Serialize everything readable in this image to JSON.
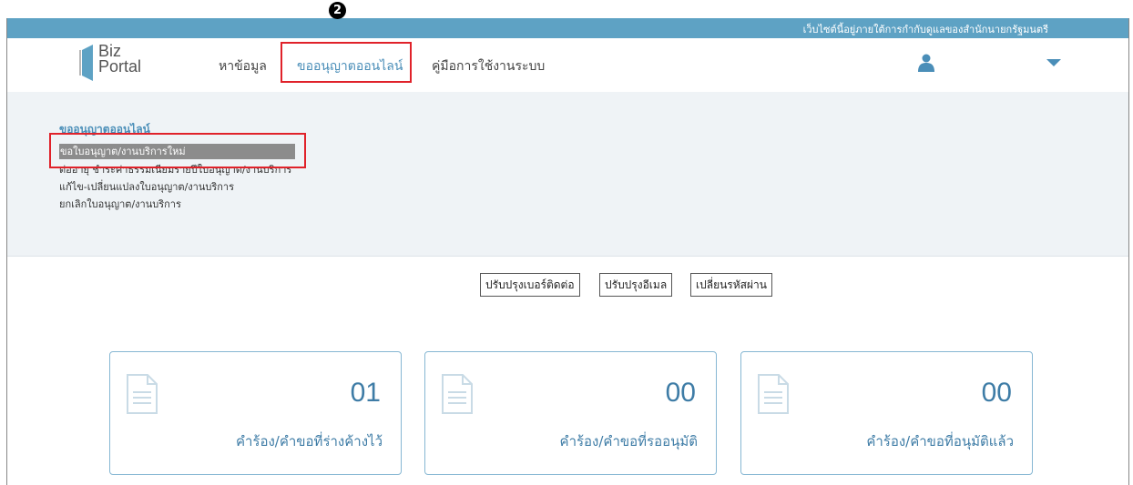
{
  "annotation": {
    "step_number": "2"
  },
  "gov_banner": {
    "text": "เว็บไซต์นี้อยู่ภายใต้การกำกับดูแลของสำนักนายกรัฐมนตรี"
  },
  "logo": {
    "line1": "Biz",
    "line2": "Portal"
  },
  "nav": {
    "items": [
      {
        "label": "หาข้อมูล"
      },
      {
        "label": "ขออนุญาตออนไลน์"
      },
      {
        "label": "คู่มือการใช้งานระบบ"
      }
    ],
    "user_icon": "user-icon",
    "menu_icon": "caret-down-icon"
  },
  "submenu": {
    "title": "ขออนุญาตออนไลน์",
    "items": [
      {
        "label": "ขอใบอนุญาต/งานบริการใหม่"
      },
      {
        "label": "ต่ออายุ ชำระค่าธรรมเนียมรายปีใบอนุญาต/งานบริการ"
      },
      {
        "label": "แก้ไข-เปลี่ยนแปลงใบอนุญาต/งานบริการ"
      },
      {
        "label": "ยกเลิกใบอนุญาต/งานบริการ"
      }
    ]
  },
  "account_buttons": {
    "update_phone": "ปรับปรุงเบอร์ติดต่อ",
    "update_email": "ปรับปรุงอีเมล",
    "change_password": "เปลี่ยนรหัสผ่าน"
  },
  "cards": [
    {
      "count": "01",
      "label": "คำร้อง/คำขอที่ร่างค้างไว้",
      "icon": "document-icon"
    },
    {
      "count": "00",
      "label": "คำร้อง/คำขอที่รออนุมัติ",
      "icon": "document-icon"
    },
    {
      "count": "00",
      "label": "คำร้อง/คำขอที่อนุมัติแล้ว",
      "icon": "document-icon"
    }
  ],
  "colors": {
    "accent": "#4a8eb8",
    "banner": "#5ea2c4",
    "highlight": "#e0222a",
    "submenu_bg": "#eff3f6"
  }
}
